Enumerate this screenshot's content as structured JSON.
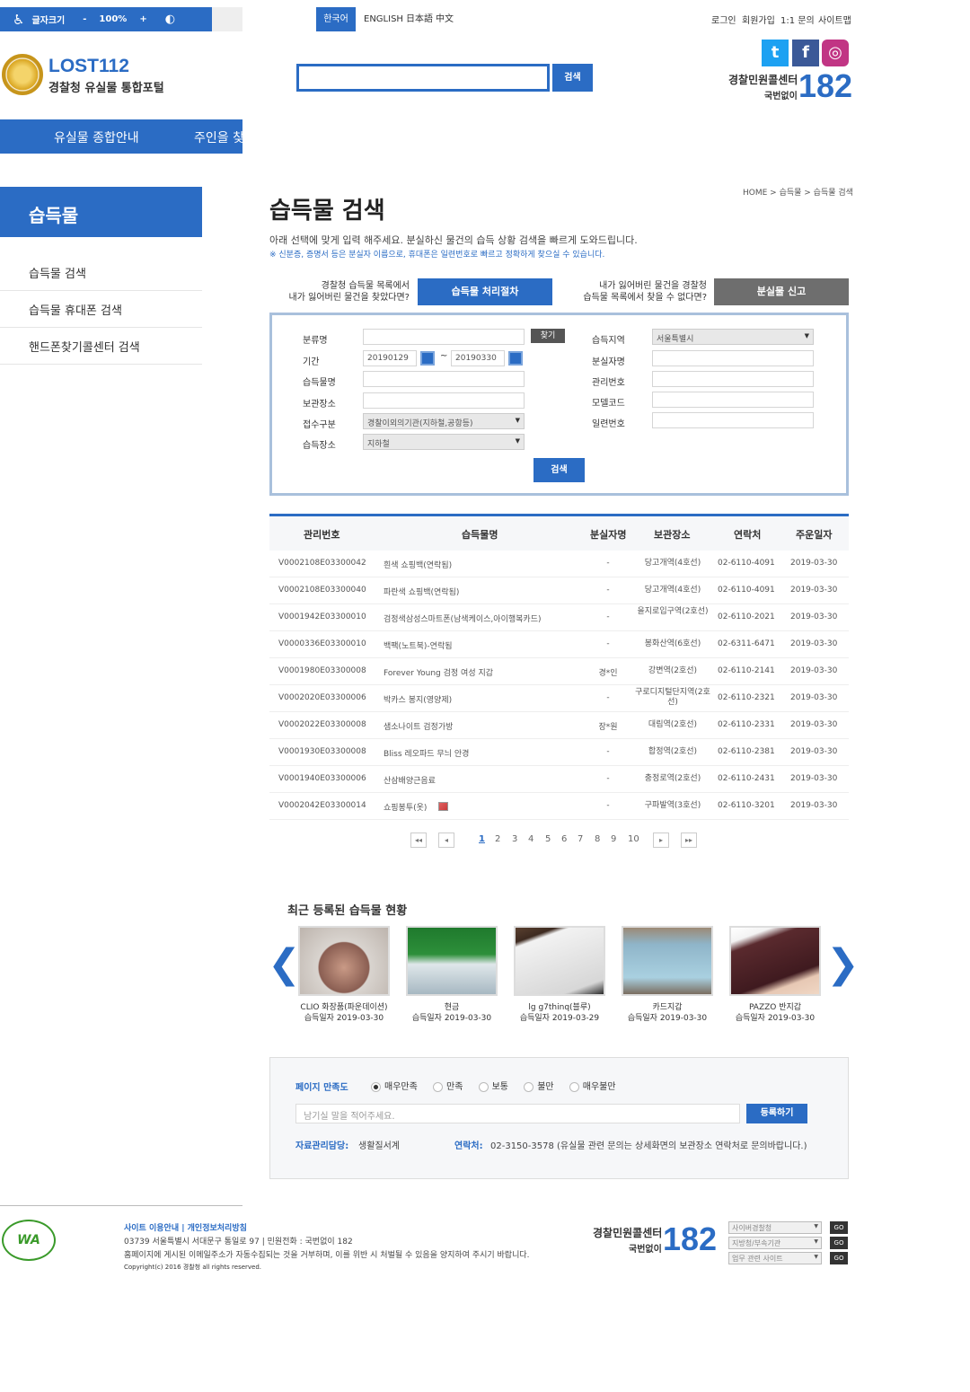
{
  "accessibility": {
    "fontsize_label": "글자크기",
    "minus": "-",
    "zoom": "100%",
    "plus": "+",
    "contrast_icon": "contrast-icon"
  },
  "languages": [
    "한국어",
    "ENGLISH",
    "日本語",
    "中文"
  ],
  "top_links": [
    "로그인",
    "회원가입",
    "1:1 문의",
    "사이트맵"
  ],
  "logo": {
    "main": "LOST112",
    "sub": "경찰청 유실물 통합포털"
  },
  "search": {
    "button": "검색",
    "value": ""
  },
  "sns": [
    "twitter-icon",
    "facebook-icon",
    "instagram-icon"
  ],
  "callcenter": {
    "label": "경찰민원콜센터",
    "sublabel": "국번없이",
    "number": "182"
  },
  "mainnav": [
    "유실물 종합안내",
    "주인을 찾"
  ],
  "sidebar": {
    "title": "습득물",
    "items": [
      "습득물 검색",
      "습득물 휴대폰 검색",
      "핸드폰찾기콜센터 검색"
    ]
  },
  "breadcrumb": "HOME > 습득물 > 습득물 검색",
  "page_title": "습득물 검색",
  "desc": "아래 선택에 맞게 입력 해주세요. 분실하신 물건의 습득 상황 검색을 빠르게 도와드립니다.",
  "desc_note": "※ 신분증, 증명서 등은 분실자 이름으로, 휴대폰은 일련번호로 빠르고 정확하게 찾으실 수 있습니다.",
  "help1": [
    "경찰청 습득물 목록에서",
    "내가 잃어버린 물건을 찾았다면?"
  ],
  "help2": [
    "내가 잃어버린 물건을 경찰청",
    "습득물 목록에서 찾을 수 없다면?"
  ],
  "btn_procedure": "습득물 처리절차",
  "btn_report": "분실물 신고",
  "form": {
    "labels_left": [
      "분류명",
      "기간",
      "습득물명",
      "보관장소",
      "접수구분",
      "습득장소"
    ],
    "labels_right": [
      "습득지역",
      "분실자명",
      "관리번호",
      "모델코드",
      "일련번호"
    ],
    "find": "찾기",
    "date_from": "20190129",
    "tilde": "~",
    "date_to": "20190330",
    "receipt_type": "경찰이외의기관(지하철,공항등)",
    "place": "지하철",
    "region": "서울특별시",
    "search": "검색"
  },
  "table": {
    "headers": [
      "관리번호",
      "습득물명",
      "분실자명",
      "보관장소",
      "연락처",
      "주운일자"
    ],
    "rows": [
      [
        "V0002108E03300042",
        "흰색 쇼핑백(연락됨)",
        "-",
        "당고개역(4호선)",
        "02-6110-4091",
        "2019-03-30"
      ],
      [
        "V0002108E03300040",
        "파란색 쇼핑백(연락됨)",
        "-",
        "당고개역(4호선)",
        "02-6110-4091",
        "2019-03-30"
      ],
      [
        "V0001942E03300010",
        "검정색삼성스마트폰(남색케이스,아이행복카드)",
        "-",
        "을지로입구역(2호선)",
        "02-6110-2021",
        "2019-03-30"
      ],
      [
        "V0000336E03300010",
        "백팩(노트북)-연락됨",
        "-",
        "봉화산역(6호선)",
        "02-6311-6471",
        "2019-03-30"
      ],
      [
        "V0001980E03300008",
        "Forever Young 검정 여성 지갑",
        "경*인",
        "강변역(2호선)",
        "02-6110-2141",
        "2019-03-30"
      ],
      [
        "V0002020E03300006",
        "박카스 봉지(영양제)",
        "-",
        "구로디지털단지역(2호선)",
        "02-6110-2321",
        "2019-03-30"
      ],
      [
        "V0002022E03300008",
        "샘소나이트 검정가방",
        "장*원",
        "대림역(2호선)",
        "02-6110-2331",
        "2019-03-30"
      ],
      [
        "V0001930E03300008",
        "Bliss 레오파드 무늬 안경",
        "-",
        "합정역(2호선)",
        "02-6110-2381",
        "2019-03-30"
      ],
      [
        "V0001940E03300006",
        "산삼배양근음료",
        "-",
        "충정로역(2호선)",
        "02-6110-2431",
        "2019-03-30"
      ],
      [
        "V0002042E03300014",
        "쇼핑봉투(옷)",
        "-",
        "구파발역(3호선)",
        "02-6110-3201",
        "2019-03-30"
      ]
    ]
  },
  "pagination": {
    "first": "◂◂",
    "prev": "◂",
    "pages": [
      "1",
      "2",
      "3",
      "4",
      "5",
      "6",
      "7",
      "8",
      "9",
      "10"
    ],
    "next": "▸",
    "last": "▸▸"
  },
  "recent": {
    "title": "최근 등록된 습득물 현황",
    "prev": "❮",
    "next": "❯",
    "items": [
      {
        "name": "CLIO 화장품(파운데이션)",
        "date": "습득일자 2019-03-30"
      },
      {
        "name": "현금",
        "date": "습득일자 2019-03-30"
      },
      {
        "name": "lg g7thinq(블루)",
        "date": "습득일자 2019-03-29"
      },
      {
        "name": "카드지갑",
        "date": "습득일자 2019-03-30"
      },
      {
        "name": "PAZZO 반지갑",
        "date": "습득일자 2019-03-30"
      }
    ]
  },
  "satisfaction": {
    "label": "페이지 만족도",
    "options": [
      "매우만족",
      "만족",
      "보통",
      "불만",
      "매우불만"
    ],
    "selected": "매우만족",
    "placeholder": "남기실 말을 적어주세요.",
    "submit": "등록하기",
    "manager_label": "자료관리담당:",
    "manager": "생활질서계",
    "contact_label": "연락처:",
    "contact": "02-3150-3578 (유실물 관련 문의는 상세화면의 보관장소 연락처로 문의바랍니다.)"
  },
  "footer": {
    "links": "사이트 이용안내 | 개인정보처리방침",
    "address": "03739 서울특별시 서대문구 통일로 97 | 민원전화 : 국번없이 182",
    "notice": "홈페이지에 게시된 이메일주소가 자동수집되는 것을 거부하며, 이를 위반 시 처벌될 수 있음을 양지하여 주시기 바랍니다.",
    "copyright": "Copyright(c) 2016 경찰청 all rights reserved.",
    "wa_mark": "WA",
    "selects": [
      "사이버경찰청",
      "지방청/부속기관",
      "업무 관련 사이트"
    ],
    "go": "GO"
  }
}
